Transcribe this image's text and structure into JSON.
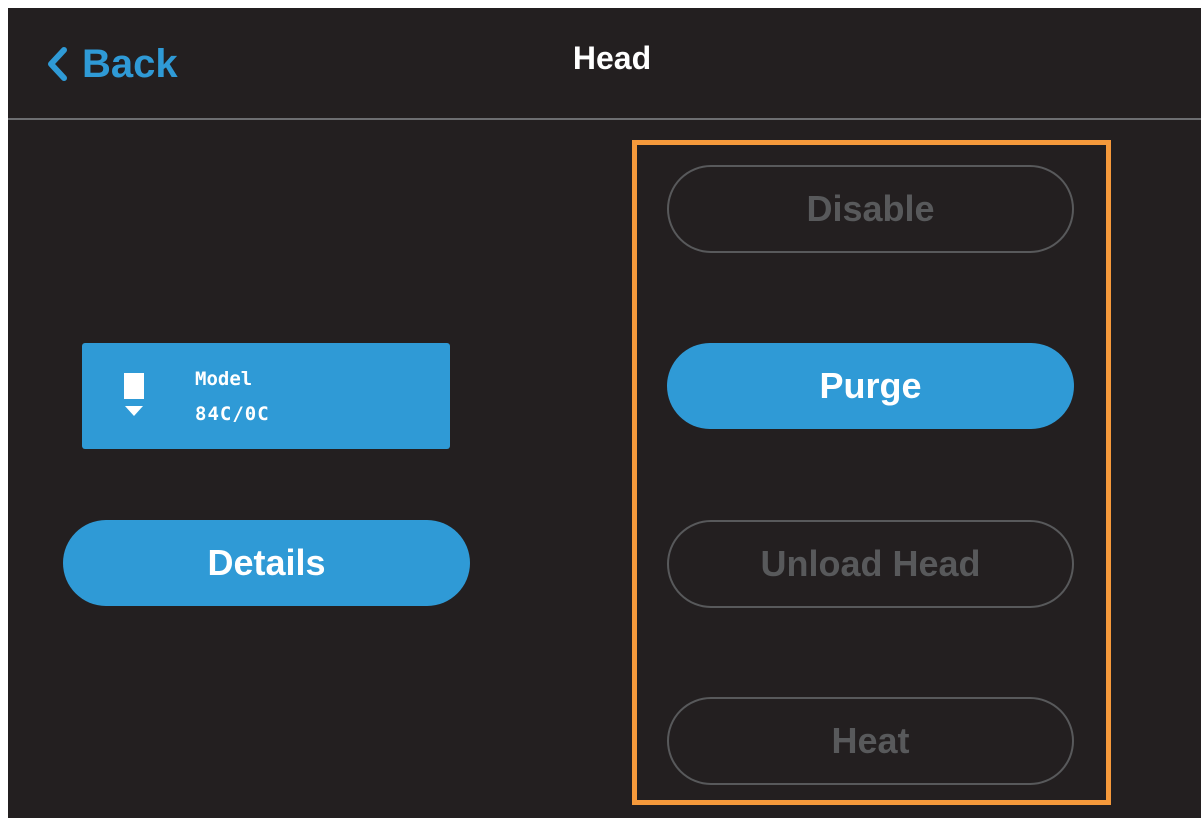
{
  "header": {
    "back_label": "Back",
    "title": "Head"
  },
  "head_card": {
    "label": "Model",
    "value": "84C/0C",
    "icon": "nozzle-icon"
  },
  "left_actions": {
    "details_label": "Details"
  },
  "actions": {
    "disable_label": "Disable",
    "purge_label": "Purge",
    "unload_label": "Unload Head",
    "heat_label": "Heat"
  },
  "colors": {
    "background": "#231f20",
    "accent": "#2f9ad6",
    "disabled": "#58595b",
    "highlight": "#f5993b",
    "divider": "#6d6e71"
  }
}
